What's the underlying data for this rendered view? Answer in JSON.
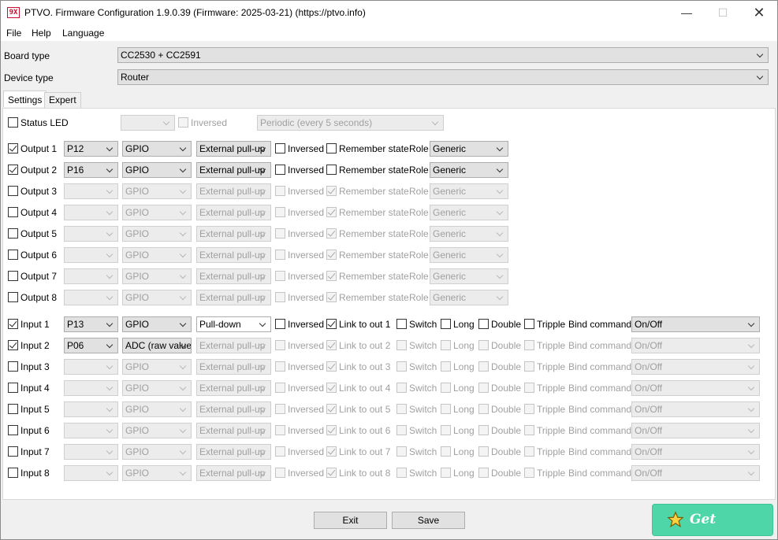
{
  "window": {
    "title": "PTVO. Firmware Configuration 1.9.0.39 (Firmware: 2025-03-21) (https://ptvo.info)",
    "icon_label": "9X",
    "minimize_glyph": "—",
    "maximize_glyph": "☐",
    "close_glyph": "✕"
  },
  "menu": [
    "File",
    "Help",
    "Language"
  ],
  "board": {
    "label": "Board type",
    "value": "CC2530 + CC2591"
  },
  "device": {
    "label": "Device type",
    "value": "Router"
  },
  "tabs": [
    "Settings",
    "Expert"
  ],
  "status_led": {
    "label": "Status LED",
    "checked": false,
    "pin": "",
    "inversed_label": "Inversed",
    "mode": "Periodic (every 5 seconds)"
  },
  "outputs": [
    {
      "label": "Output 1",
      "checked": true,
      "pin": "P12",
      "mode": "GPIO",
      "pull": "External pull-up",
      "inversed_label": "Inversed",
      "inversed": false,
      "remember_label": "Remember state",
      "remember": false,
      "role_label": "Role",
      "role": "Generic"
    },
    {
      "label": "Output 2",
      "checked": true,
      "pin": "P16",
      "mode": "GPIO",
      "pull": "External pull-up",
      "inversed_label": "Inversed",
      "inversed": false,
      "remember_label": "Remember state",
      "remember": false,
      "role_label": "Role",
      "role": "Generic"
    },
    {
      "label": "Output 3",
      "checked": false,
      "pin": "",
      "mode": "GPIO",
      "pull": "External pull-up",
      "inversed_label": "Inversed",
      "inversed": false,
      "remember_label": "Remember state",
      "remember": true,
      "role_label": "Role",
      "role": "Generic"
    },
    {
      "label": "Output 4",
      "checked": false,
      "pin": "",
      "mode": "GPIO",
      "pull": "External pull-up",
      "inversed_label": "Inversed",
      "inversed": false,
      "remember_label": "Remember state",
      "remember": true,
      "role_label": "Role",
      "role": "Generic"
    },
    {
      "label": "Output 5",
      "checked": false,
      "pin": "",
      "mode": "GPIO",
      "pull": "External pull-up",
      "inversed_label": "Inversed",
      "inversed": false,
      "remember_label": "Remember state",
      "remember": true,
      "role_label": "Role",
      "role": "Generic"
    },
    {
      "label": "Output 6",
      "checked": false,
      "pin": "",
      "mode": "GPIO",
      "pull": "External pull-up",
      "inversed_label": "Inversed",
      "inversed": false,
      "remember_label": "Remember state",
      "remember": true,
      "role_label": "Role",
      "role": "Generic"
    },
    {
      "label": "Output 7",
      "checked": false,
      "pin": "",
      "mode": "GPIO",
      "pull": "External pull-up",
      "inversed_label": "Inversed",
      "inversed": false,
      "remember_label": "Remember state",
      "remember": true,
      "role_label": "Role",
      "role": "Generic"
    },
    {
      "label": "Output 8",
      "checked": false,
      "pin": "",
      "mode": "GPIO",
      "pull": "External pull-up",
      "inversed_label": "Inversed",
      "inversed": false,
      "remember_label": "Remember state",
      "remember": true,
      "role_label": "Role",
      "role": "Generic"
    }
  ],
  "inputs": [
    {
      "label": "Input 1",
      "checked": true,
      "pin": "P13",
      "mode": "GPIO",
      "pull": "Pull-down",
      "inversed_label": "Inversed",
      "inversed": false,
      "link_label": "Link to out 1",
      "link": true,
      "switch_label": "Switch",
      "long_label": "Long",
      "double_label": "Double",
      "tripple_label": "Tripple",
      "bind_label": "Bind command",
      "bind": "On/Off"
    },
    {
      "label": "Input 2",
      "checked": true,
      "pin": "P06",
      "mode": "ADC (raw value)",
      "pull": "External pull-up",
      "inversed_label": "Inversed",
      "inversed": false,
      "link_label": "Link to out 2",
      "link": true,
      "switch_label": "Switch",
      "long_label": "Long",
      "double_label": "Double",
      "tripple_label": "Tripple",
      "bind_label": "Bind command",
      "bind": "On/Off"
    },
    {
      "label": "Input 3",
      "checked": false,
      "pin": "",
      "mode": "GPIO",
      "pull": "External pull-up",
      "inversed_label": "Inversed",
      "inversed": false,
      "link_label": "Link to out 3",
      "link": true,
      "switch_label": "Switch",
      "long_label": "Long",
      "double_label": "Double",
      "tripple_label": "Tripple",
      "bind_label": "Bind command",
      "bind": "On/Off"
    },
    {
      "label": "Input 4",
      "checked": false,
      "pin": "",
      "mode": "GPIO",
      "pull": "External pull-up",
      "inversed_label": "Inversed",
      "inversed": false,
      "link_label": "Link to out 4",
      "link": true,
      "switch_label": "Switch",
      "long_label": "Long",
      "double_label": "Double",
      "tripple_label": "Tripple",
      "bind_label": "Bind command",
      "bind": "On/Off"
    },
    {
      "label": "Input 5",
      "checked": false,
      "pin": "",
      "mode": "GPIO",
      "pull": "External pull-up",
      "inversed_label": "Inversed",
      "inversed": false,
      "link_label": "Link to out 5",
      "link": true,
      "switch_label": "Switch",
      "long_label": "Long",
      "double_label": "Double",
      "tripple_label": "Tripple",
      "bind_label": "Bind command",
      "bind": "On/Off"
    },
    {
      "label": "Input 6",
      "checked": false,
      "pin": "",
      "mode": "GPIO",
      "pull": "External pull-up",
      "inversed_label": "Inversed",
      "inversed": false,
      "link_label": "Link to out 6",
      "link": true,
      "switch_label": "Switch",
      "long_label": "Long",
      "double_label": "Double",
      "tripple_label": "Tripple",
      "bind_label": "Bind command",
      "bind": "On/Off"
    },
    {
      "label": "Input 7",
      "checked": false,
      "pin": "",
      "mode": "GPIO",
      "pull": "External pull-up",
      "inversed_label": "Inversed",
      "inversed": false,
      "link_label": "Link to out 7",
      "link": true,
      "switch_label": "Switch",
      "long_label": "Long",
      "double_label": "Double",
      "tripple_label": "Tripple",
      "bind_label": "Bind command",
      "bind": "On/Off"
    },
    {
      "label": "Input 8",
      "checked": false,
      "pin": "",
      "mode": "GPIO",
      "pull": "External pull-up",
      "inversed_label": "Inversed",
      "inversed": false,
      "link_label": "Link to out 8",
      "link": true,
      "switch_label": "Switch",
      "long_label": "Long",
      "double_label": "Double",
      "tripple_label": "Tripple",
      "bind_label": "Bind command",
      "bind": "On/Off"
    }
  ],
  "buttons": {
    "exit": "Exit",
    "save": "Save"
  },
  "premium": {
    "label": "Get Premium",
    "icon": "star-icon",
    "color": "#4fd6a8"
  }
}
